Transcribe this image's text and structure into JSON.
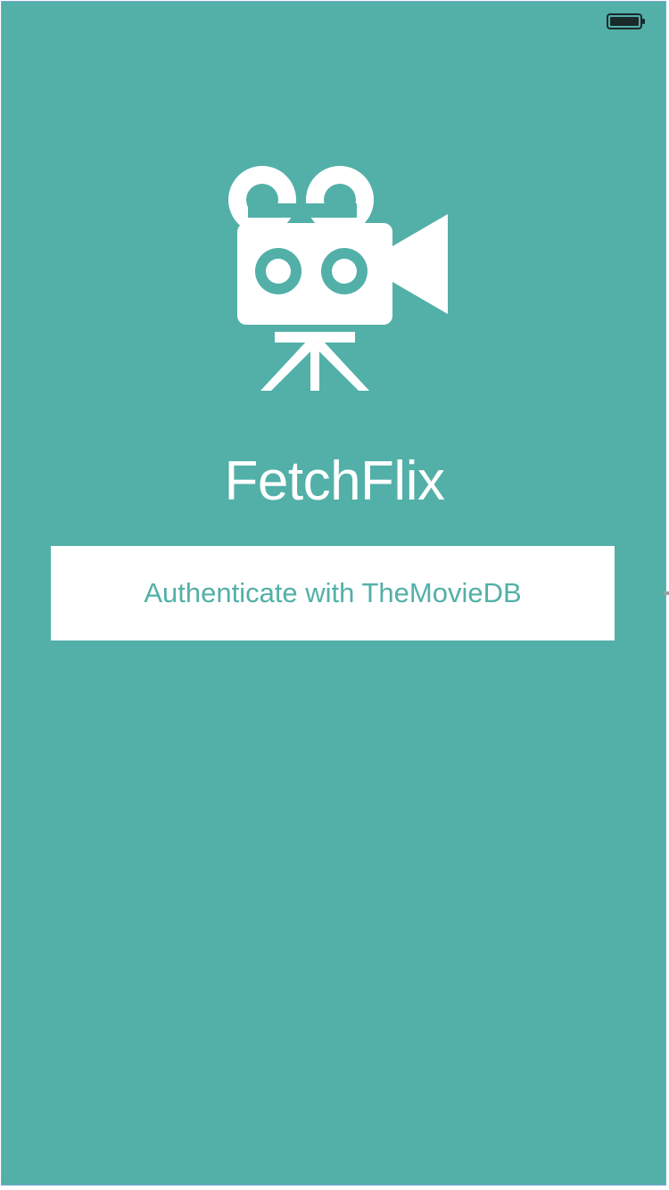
{
  "app": {
    "title": "FetchFlix",
    "logo_icon": "movie-camera-icon"
  },
  "status_bar": {
    "battery_icon": "battery-full-icon"
  },
  "auth": {
    "button_label": "Authenticate with TheMovieDB"
  },
  "colors": {
    "background": "#52b0a8",
    "button_background": "#ffffff",
    "button_text": "#52b0a8",
    "title_text": "#ffffff"
  }
}
